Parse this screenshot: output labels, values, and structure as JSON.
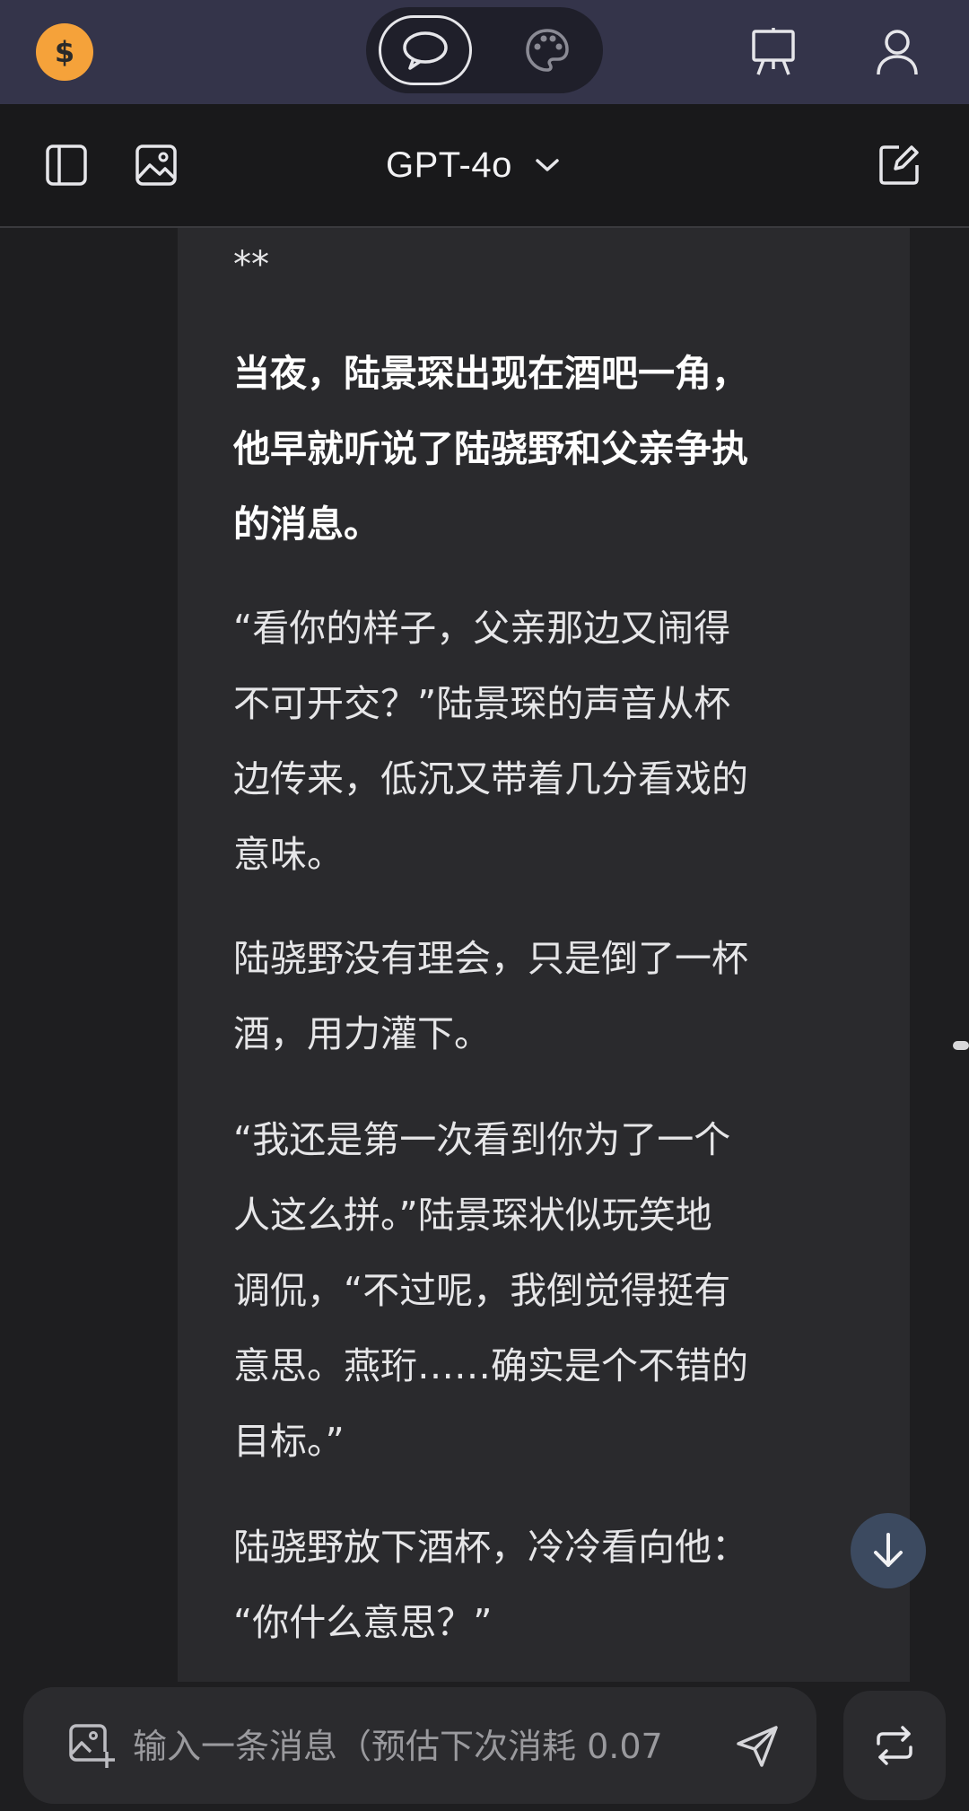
{
  "header": {
    "coin_icon": "dollar-coin-icon",
    "modes": [
      {
        "name": "chat",
        "icon": "chat-bubble-icon",
        "active": true
      },
      {
        "name": "paint",
        "icon": "palette-icon",
        "active": false
      }
    ],
    "right_icons": [
      "easel-icon",
      "user-icon"
    ],
    "colors": {
      "bar": "#34344a",
      "coin": "#f5a23a"
    }
  },
  "toolbar": {
    "model_name": "GPT-4o",
    "icons": [
      "sidebar-icon",
      "image-icon",
      "chevron-down-icon",
      "new-chat-icon"
    ]
  },
  "message": {
    "stars": "**",
    "paragraphs": [
      {
        "text": "当夜，陆景琛出现在酒吧一角，\n他早就听说了陆骁野和父亲争执\n的消息。",
        "bold": true
      },
      {
        "text": "“看你的样子，父亲那边又闹得\n不可开交？”陆景琛的声音从杯\n边传来，低沉又带着几分看戏的\n意味。",
        "bold": false
      },
      {
        "text": "陆骁野没有理会，只是倒了一杯\n酒，用力灌下。",
        "bold": false
      },
      {
        "text": "“我还是第一次看到你为了一个\n人这么拼。”陆景琛状似玩笑地\n调侃，“不过呢，我倒觉得挺有\n意思。燕珩……确实是个不错的\n目标。”",
        "bold": false
      },
      {
        "text": "陆骁野放下酒杯，冷冷看向他：\n“你什么意思？”",
        "bold": false
      }
    ]
  },
  "input": {
    "placeholder": "输入一条消息（预估下次消耗 0.07",
    "value": ""
  },
  "buttons": {
    "scroll_down_icon": "arrow-down-icon",
    "send_icon": "send-icon",
    "regenerate_icon": "repeat-icon"
  }
}
